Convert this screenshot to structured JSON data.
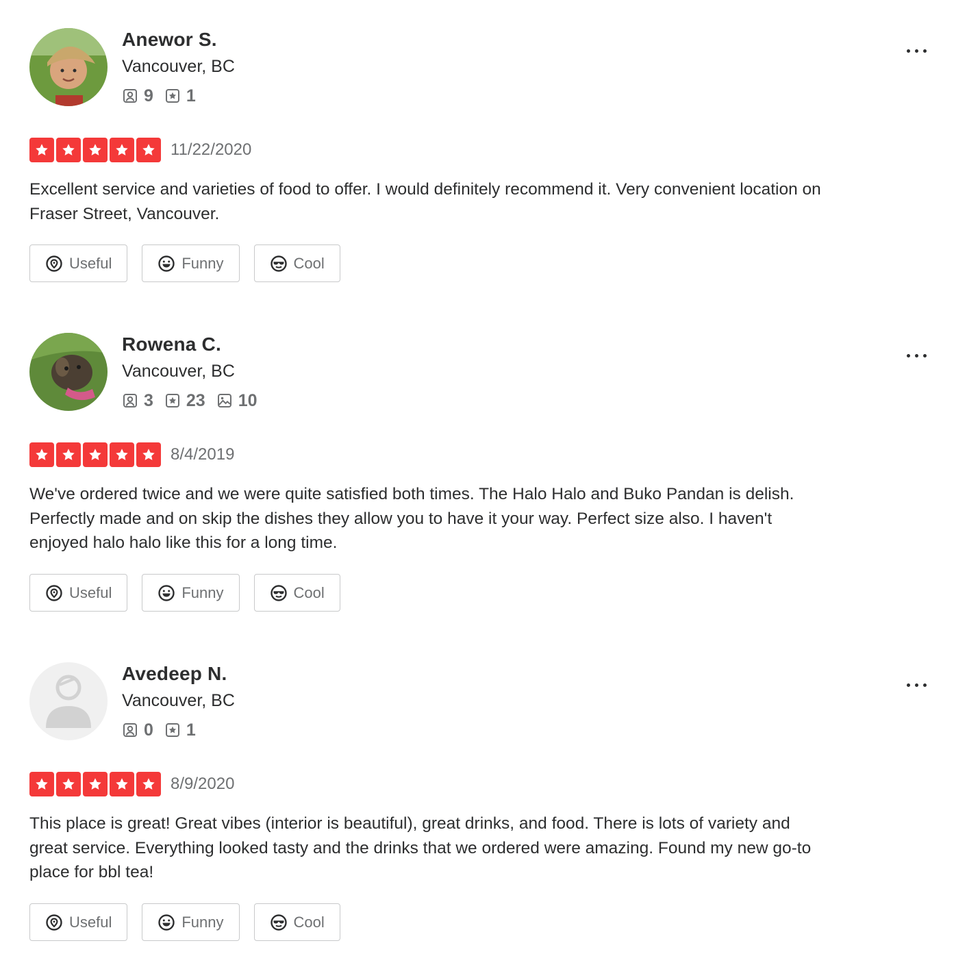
{
  "colors": {
    "star_bg": "#f43939",
    "text": "#2d2e2f",
    "muted": "#6e7072"
  },
  "labels": {
    "useful": "Useful",
    "funny": "Funny",
    "cool": "Cool"
  },
  "reviews": [
    {
      "name": "Anewor S.",
      "location": "Vancouver, BC",
      "friends": "9",
      "reviews_count": "1",
      "rating": 5,
      "date": "11/22/2020",
      "text": "Excellent service and varieties of food to offer. I would definitely recommend it. Very convenient location on Fraser Street, Vancouver."
    },
    {
      "name": "Rowena C.",
      "location": "Vancouver, BC",
      "friends": "3",
      "reviews_count": "23",
      "photos": "10",
      "rating": 5,
      "date": "8/4/2019",
      "text": "We've ordered twice and we were quite satisfied both times. The Halo Halo and Buko Pandan is delish. Perfectly made and on skip the dishes they allow you to have it your way.  Perfect size also.  I haven't enjoyed halo halo like this for a long time."
    },
    {
      "name": "Avedeep N.",
      "location": "Vancouver, BC",
      "friends": "0",
      "reviews_count": "1",
      "rating": 5,
      "date": "8/9/2020",
      "text": "This place is great! Great vibes (interior is beautiful), great drinks, and food. There is lots of variety and great service. Everything looked tasty and the drinks that we ordered were amazing. Found my new go-to place for bbl tea!"
    }
  ]
}
